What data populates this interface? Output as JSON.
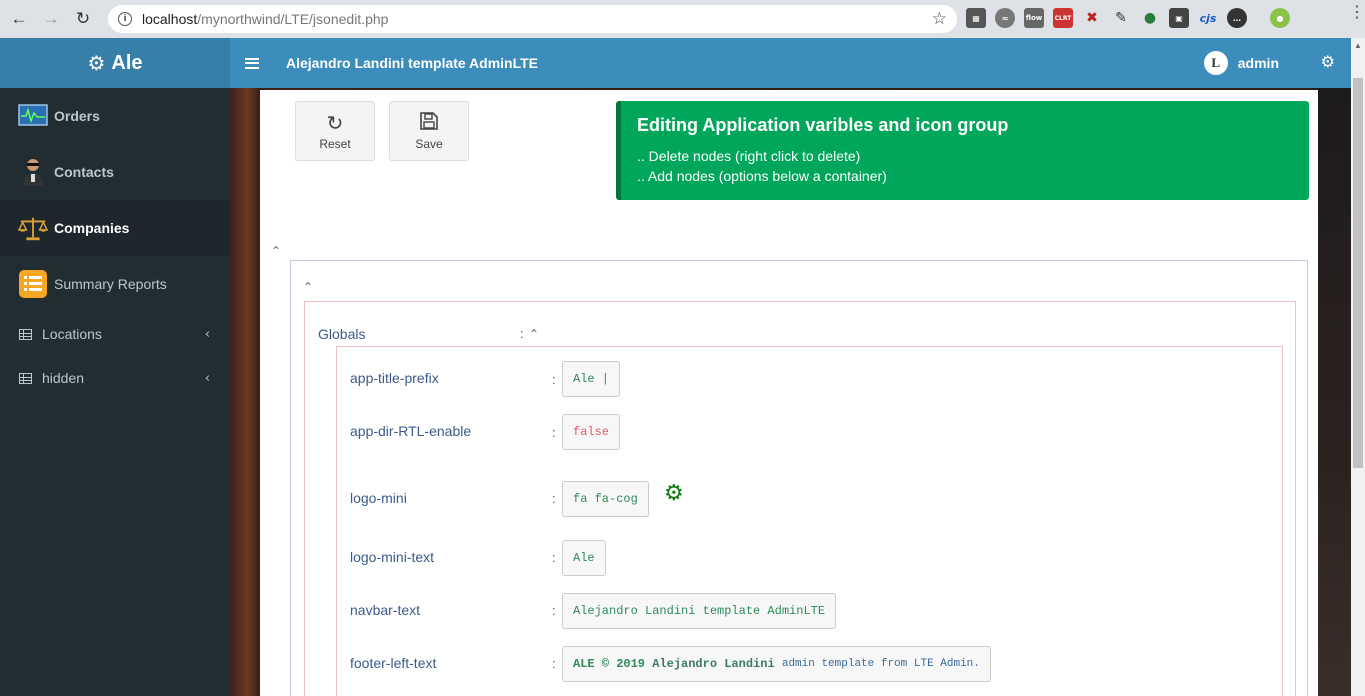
{
  "browser": {
    "url_host": "localhost",
    "url_path": "/mynorthwind/LTE/jsonedit.php",
    "extensions": [
      "qr-icon",
      "spotify-icon",
      "flow-icon",
      "clrt-icon",
      "tools-icon",
      "pen-icon",
      "eyedropper-icon",
      "resize-icon",
      "cjs-icon",
      "chat-icon",
      "profile-icon"
    ],
    "ext_labels": {
      "flow": "flow",
      "clrt": "CLRT",
      "cjs": "cjs"
    }
  },
  "header": {
    "logo_text": "Ale",
    "title": "Alejandro Landini template AdminLTE",
    "user_name": "admin",
    "avatar_letter": "L"
  },
  "sidebar": {
    "items": [
      {
        "label": "Orders",
        "icon": "monitor-chart-icon"
      },
      {
        "label": "Contacts",
        "icon": "person-icon"
      },
      {
        "label": "Companies",
        "icon": "scales-icon",
        "active": true
      },
      {
        "label": "Summary Reports",
        "icon": "list-report-icon"
      },
      {
        "label": "Locations",
        "icon": "table-icon"
      },
      {
        "label": "hidden",
        "icon": "table-icon"
      }
    ]
  },
  "toolbar": {
    "reset_label": "Reset",
    "save_label": "Save"
  },
  "callout": {
    "title": "Editing Application varibles and icon group",
    "line1": ".. Delete nodes (right click to delete)",
    "line2": ".. Add nodes (options below a container)",
    "color": "#00a65a"
  },
  "editor": {
    "group_label": "Globals",
    "colon": ":",
    "properties": [
      {
        "key": "app-title-prefix",
        "value": "Ale |"
      },
      {
        "key": "app-dir-RTL-enable",
        "value": "false"
      },
      {
        "key": "logo-mini",
        "value": "fa fa-cog"
      },
      {
        "key": "logo-mini-text",
        "value": "Ale"
      },
      {
        "key": "navbar-text",
        "value": "Alejandro Landini template AdminLTE"
      },
      {
        "key": "footer-left-text",
        "value_part1": "ALE © 2019",
        "value_part2": "Alejandro Landini",
        "value_part3": "admin template from LTE Admin."
      }
    ]
  }
}
